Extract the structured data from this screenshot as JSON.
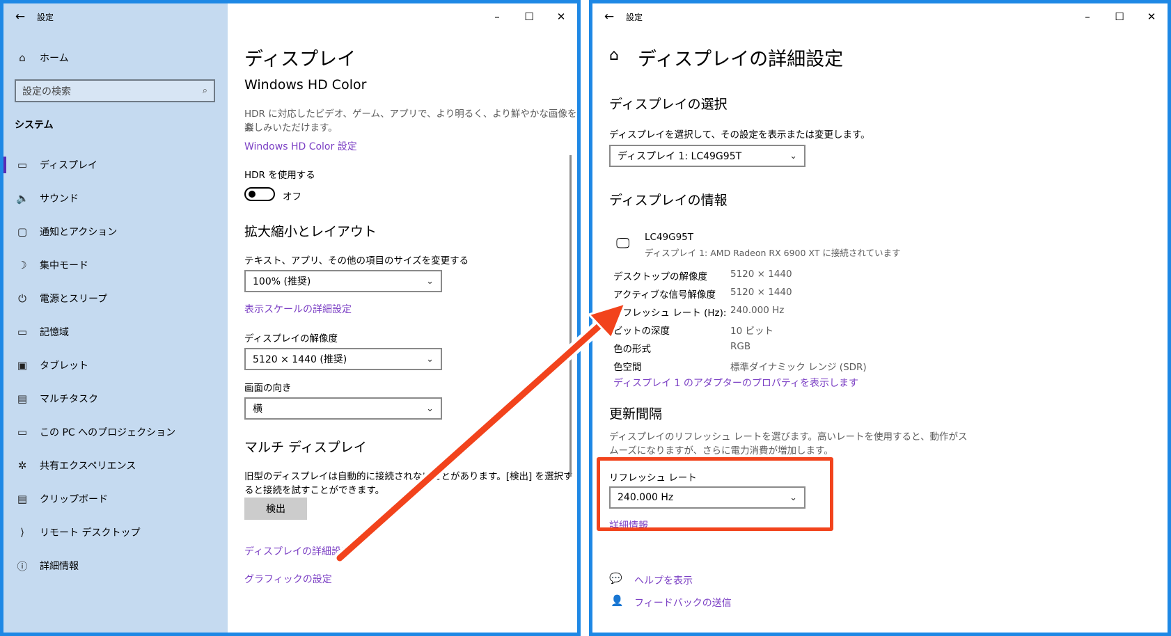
{
  "left_window": {
    "title": "設定",
    "back_icon": "←",
    "window_controls": {
      "minimize": "–",
      "maximize": "☐",
      "close": "✕"
    },
    "sidebar": {
      "home_label": "ホーム",
      "search_placeholder": "設定の検索",
      "section_label": "システム",
      "items": [
        {
          "label": "ディスプレイ",
          "icon": "display-icon",
          "glyph": "▭",
          "active": true
        },
        {
          "label": "サウンド",
          "icon": "sound-icon",
          "glyph": "🔈",
          "active": false
        },
        {
          "label": "通知とアクション",
          "icon": "notification-icon",
          "glyph": "▢",
          "active": false
        },
        {
          "label": "集中モード",
          "icon": "moon-icon",
          "glyph": "☽",
          "active": false
        },
        {
          "label": "電源とスリープ",
          "icon": "power-icon",
          "glyph": "⏻",
          "active": false
        },
        {
          "label": "記憶域",
          "icon": "storage-icon",
          "glyph": "▭",
          "active": false
        },
        {
          "label": "タブレット",
          "icon": "tablet-icon",
          "glyph": "▣",
          "active": false
        },
        {
          "label": "マルチタスク",
          "icon": "multitask-icon",
          "glyph": "▤",
          "active": false
        },
        {
          "label": "この PC へのプロジェクション",
          "icon": "projection-icon",
          "glyph": "▭",
          "active": false
        },
        {
          "label": "共有エクスペリエンス",
          "icon": "share-icon",
          "glyph": "✲",
          "active": false
        },
        {
          "label": "クリップボード",
          "icon": "clipboard-icon",
          "glyph": "▤",
          "active": false
        },
        {
          "label": "リモート デスクトップ",
          "icon": "remote-icon",
          "glyph": "⟩",
          "active": false
        },
        {
          "label": "詳細情報",
          "icon": "info-icon",
          "glyph": "ⓘ",
          "active": false
        }
      ]
    },
    "main": {
      "page_title": "ディスプレイ",
      "hd_color_heading": "Windows HD Color",
      "hd_color_desc_1": "HDR に対応したビデオ、ゲーム、アプリで、より明るく、より鮮やかな画像をお",
      "hd_color_desc_2": "楽しみいただけます。",
      "hd_color_link": "Windows HD Color 設定",
      "hdr_label": "HDR を使用する",
      "hdr_state": "オフ",
      "scale_heading": "拡大縮小とレイアウト",
      "text_size_label": "テキスト、アプリ、その他の項目のサイズを変更する",
      "scale_value": "100% (推奨)",
      "scale_link": "表示スケールの詳細設定",
      "resolution_label": "ディスプレイの解像度",
      "resolution_value": "5120 × 1440 (推奨)",
      "orientation_label": "画面の向き",
      "orientation_value": "横",
      "multi_heading": "マルチ ディスプレイ",
      "multi_desc_1": "旧型のディスプレイは自動的に接続されないことがあります。[検出] を選択す",
      "multi_desc_2": "ると接続を試すことができます。",
      "detect_button": "検出",
      "advanced_link": "ディスプレイの詳細設定",
      "graphics_link": "グラフィックの設定"
    }
  },
  "right_window": {
    "title": "設定",
    "back_icon": "←",
    "window_controls": {
      "minimize": "–",
      "maximize": "☐",
      "close": "✕"
    },
    "home_icon": "⌂",
    "page_title": "ディスプレイの詳細設定",
    "select_heading": "ディスプレイの選択",
    "select_desc": "ディスプレイを選択して、その設定を表示または変更します。",
    "display_select_value": "ディスプレイ 1: LC49G95T",
    "info_heading": "ディスプレイの情報",
    "monitor_name": "LC49G95T",
    "monitor_sub": "ディスプレイ 1: AMD Radeon RX 6900 XT に接続されています",
    "info_rows": [
      {
        "key": "デスクトップの解像度",
        "value": "5120 × 1440"
      },
      {
        "key": "アクティブな信号解像度",
        "value": "5120 × 1440"
      },
      {
        "key": "リフレッシュ レート (Hz):",
        "value": "240.000 Hz"
      },
      {
        "key": "ビットの深度",
        "value": "10 ビット"
      },
      {
        "key": "色の形式",
        "value": "RGB"
      },
      {
        "key": "色空間",
        "value": "標準ダイナミック レンジ (SDR)"
      }
    ],
    "adapter_link": "ディスプレイ 1 のアダプターのプロパティを表示します",
    "refresh_heading": "更新間隔",
    "refresh_desc_1": "ディスプレイのリフレッシュ レートを選びます。高いレートを使用すると、動作がス",
    "refresh_desc_2": "ムーズになりますが、さらに電力消費が増加します。",
    "refresh_label": "リフレッシュ レート",
    "refresh_value": "240.000 Hz",
    "details_link": "詳細情報",
    "help_link": "ヘルプを表示",
    "feedback_link": "フィードバックの送信"
  },
  "annotation_colors": {
    "arrow": "#f2431c",
    "window_border": "#1e88e5",
    "link": "#7b3fc4"
  }
}
